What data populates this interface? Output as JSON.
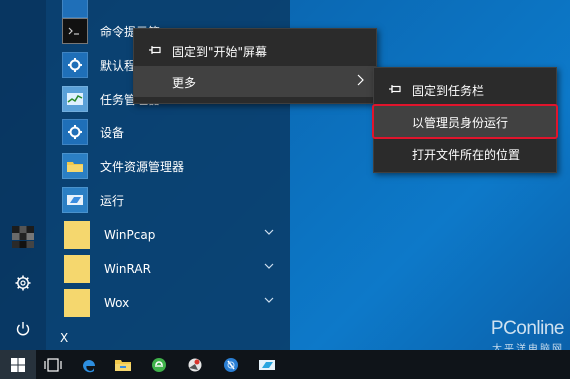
{
  "app_list": {
    "items": [
      {
        "label": "命令提示符",
        "icon": "cmd-icon"
      },
      {
        "label": "默认程序",
        "icon": "gear-icon"
      },
      {
        "label": "任务管理器",
        "icon": "task-manager-icon"
      },
      {
        "label": "设备",
        "icon": "gear-icon"
      },
      {
        "label": "文件资源管理器",
        "icon": "folder-explorer-icon"
      },
      {
        "label": "运行",
        "icon": "run-icon"
      }
    ],
    "folders": [
      {
        "label": "WinPcap",
        "icon": "folder-icon"
      },
      {
        "label": "WinRAR",
        "icon": "folder-icon"
      },
      {
        "label": "Wox",
        "icon": "folder-icon"
      }
    ],
    "section_letter": "X"
  },
  "context_menu": {
    "items": [
      {
        "label": "固定到\"开始\"屏幕",
        "icon": "pin-icon"
      },
      {
        "label": "更多",
        "icon": "chevron-right-icon"
      }
    ]
  },
  "submenu": {
    "items": [
      {
        "label": "固定到任务栏",
        "icon": "pin-icon"
      },
      {
        "label": "以管理员身份运行"
      },
      {
        "label": "打开文件所在的位置"
      }
    ]
  },
  "taskbar": {
    "icons": [
      "windows-start-icon",
      "task-view-icon",
      "edge-icon",
      "file-explorer-icon",
      "app-green-icon",
      "app-red-icon",
      "app-blue-icon",
      "app-cyan-icon"
    ]
  },
  "watermark": {
    "brand": "PConline",
    "sub": "太平洋电脑网"
  },
  "colors": {
    "highlight_border": "#e0142c",
    "menu_bg": "#2b2b2b",
    "taskbar_bg": "#0f1419"
  }
}
